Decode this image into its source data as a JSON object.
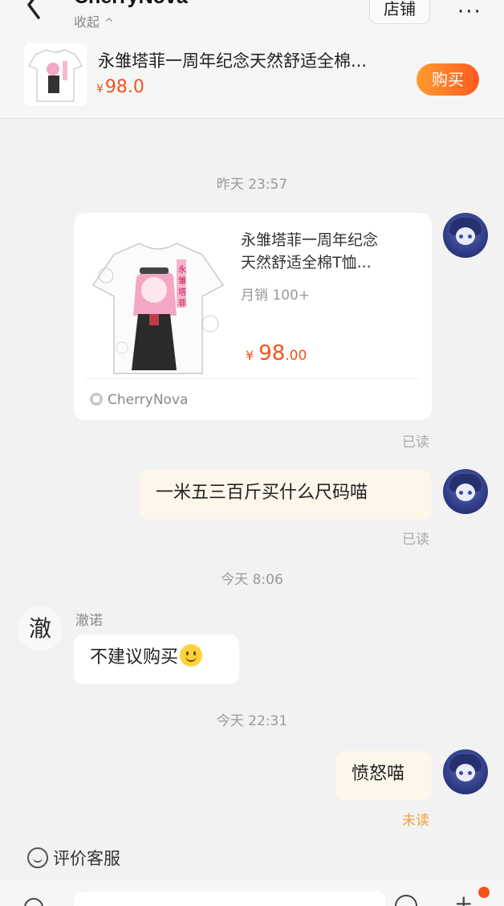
{
  "header": {
    "title": "CherryNova",
    "collapse_label": "收起",
    "shop_label": "店铺",
    "more_label": "···"
  },
  "pinned_product": {
    "title": "永雏塔菲一周年纪念天然舒适全棉...",
    "currency": "¥",
    "price": "98.0",
    "buy_label": "购买"
  },
  "chat": {
    "timestamps": [
      "昨天 23:57",
      "今天 8:06",
      "今天 22:31"
    ],
    "product_card": {
      "title_line1": "永雏塔菲一周年纪念",
      "title_line2": "天然舒适全棉T恤...",
      "sales": "月销 100+",
      "currency": "¥",
      "price_int": "98",
      "price_dec": ".00",
      "shop_name": "CherryNova",
      "read_status": "已读"
    },
    "msg_size_question": {
      "text": "一米五三百斤买什么尺码喵",
      "read_status": "已读"
    },
    "staff": {
      "name": "澈诺",
      "avatar_char": "澈",
      "reply": "不建议购买"
    },
    "msg_angry": {
      "text": "愤怒喵",
      "read_status": "未读"
    }
  },
  "bottom": {
    "rate_label": "评价客服"
  },
  "colors": {
    "accent": "#f2541b",
    "buy_gradient_start": "#ff9b2e",
    "mine_bubble": "#fdf6ea",
    "background": "#f2f2f2"
  },
  "icons": [
    "back-icon",
    "chevron-up-icon",
    "more-icon",
    "shop-icon",
    "smile-emoji-icon",
    "rate-smile-icon",
    "voice-icon",
    "emoji-button-icon",
    "plus-icon"
  ]
}
